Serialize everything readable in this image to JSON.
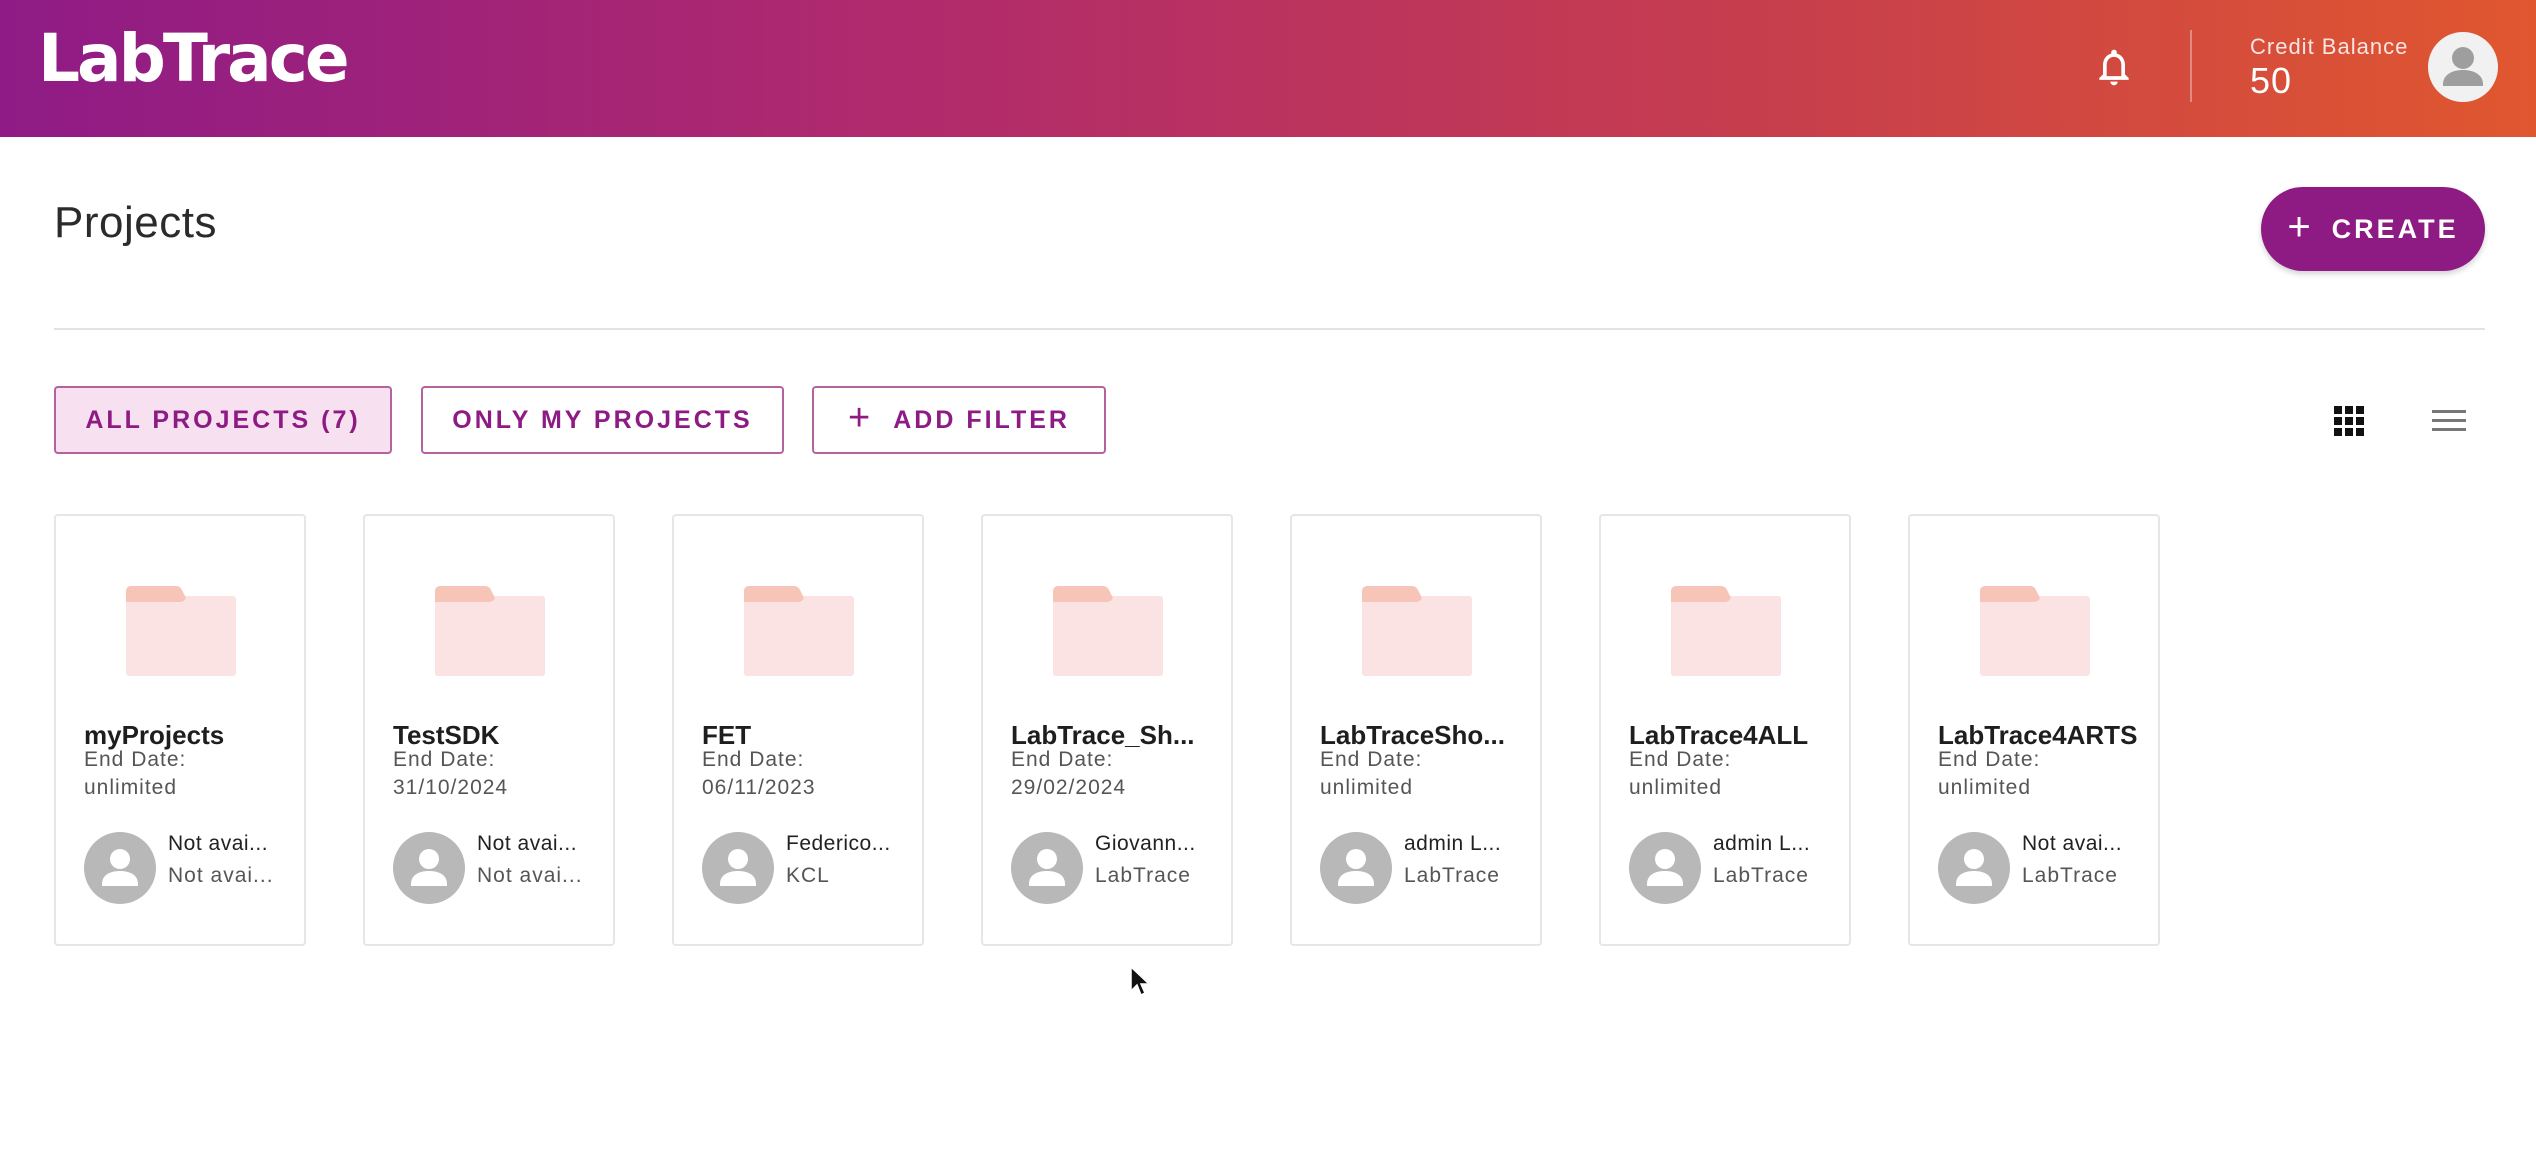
{
  "header": {
    "logo_text": "LabTrace",
    "bell_icon": "bell-icon",
    "credit_label": "Credit Balance",
    "credit_value": "50",
    "avatar_icon": "user-avatar-icon"
  },
  "page": {
    "title": "Projects",
    "create_label": "CREATE",
    "create_icon": "plus-icon"
  },
  "filters": {
    "all_label": "ALL PROJECTS (7)",
    "mine_label": "ONLY MY PROJECTS",
    "add_label": "ADD FILTER",
    "view_grid_icon": "grid-view-icon",
    "view_list_icon": "list-view-icon"
  },
  "colors": {
    "brand": "#8e1a83",
    "gradient_start": "#8f1b86",
    "gradient_end": "#e0572f",
    "folder": "#f8d7d5"
  },
  "projects": [
    {
      "name": "myProjects",
      "end_label": "End Date:",
      "end_date": "unlimited",
      "owner": "Not avai...",
      "org": "Not avai..."
    },
    {
      "name": "TestSDK",
      "end_label": "End Date:",
      "end_date": "31/10/2024",
      "owner": "Not avai...",
      "org": "Not avai..."
    },
    {
      "name": "FET",
      "end_label": "End Date:",
      "end_date": "06/11/2023",
      "owner": "Federico...",
      "org": "KCL"
    },
    {
      "name": "LabTrace_Sh...",
      "end_label": "End Date:",
      "end_date": "29/02/2024",
      "owner": "Giovann...",
      "org": "LabTrace"
    },
    {
      "name": "LabTraceSho...",
      "end_label": "End Date:",
      "end_date": "unlimited",
      "owner": "admin L...",
      "org": "LabTrace"
    },
    {
      "name": "LabTrace4ALL",
      "end_label": "End Date:",
      "end_date": "unlimited",
      "owner": "admin L...",
      "org": "LabTrace"
    },
    {
      "name": "LabTrace4ARTS",
      "end_label": "End Date:",
      "end_date": "unlimited",
      "owner": "Not avai...",
      "org": "LabTrace"
    }
  ]
}
